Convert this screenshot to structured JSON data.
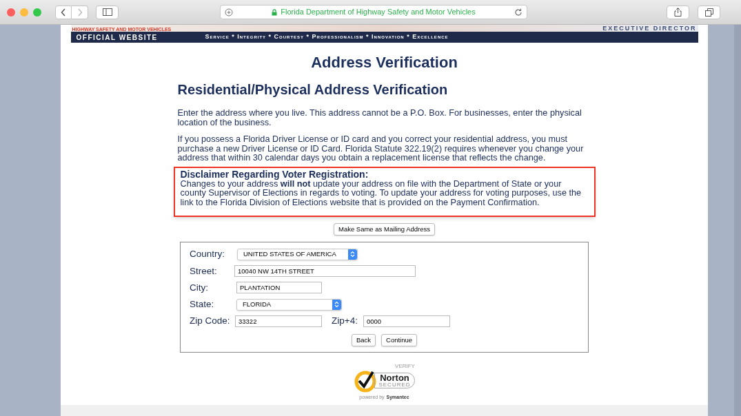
{
  "browser": {
    "address": "Florida Department of Highway Safety and Motor Vehicles",
    "secure": true
  },
  "header": {
    "agency": "HIGHWAY SAFETY AND MOTOR VEHICLES",
    "director": "EXECUTIVE DIRECTOR",
    "site_label": "OFFICIAL WEBSITE",
    "motto": "Service * Integrity * Courtesy * Professionalism * Innovation * Excellence"
  },
  "page_title": "Address Verification",
  "section_title": "Residential/Physical Address Verification",
  "paragraphs": [
    "Enter the address where you live. This address cannot be a P.O. Box. For businesses, enter the physical location of the business.",
    "If you possess a Florida Driver License or ID card and you correct your residential address, you must purchase a new Driver License or ID Card. Florida Statute 322.19(2) requires whenever you change your address that within 30 calendar days you obtain a replacement license that reflects the change."
  ],
  "disclaimer": {
    "title": "Disclaimer Regarding Voter Registration:",
    "text": "Changes to your address **will not** update your address on file with the Department of State or your county Supervisor of Elections in regards to voting. To update your address for voting purposes, use the link to the Florida Division of Elections website that is provided on the Payment Confirmation."
  },
  "same_button": "Make Same as Mailing Address",
  "form": {
    "country": {
      "label": "Country:",
      "value": "UNITED STATES OF AMERICA"
    },
    "street": {
      "label": "Street:",
      "value": "10040 NW 14TH STREET"
    },
    "city": {
      "label": "City:",
      "value": "PLANTATION"
    },
    "state": {
      "label": "State:",
      "value": "FLORIDA"
    },
    "zip": {
      "label": "Zip Code:",
      "value": "33322"
    },
    "zip4": {
      "label": "Zip+4:",
      "value": "0000"
    }
  },
  "buttons": [
    "Back",
    "Continue"
  ],
  "seal": {
    "verify": "VERIFY",
    "brand": "Norton",
    "secured": "SECURED",
    "powered": "powered by",
    "company": "Symantec"
  }
}
